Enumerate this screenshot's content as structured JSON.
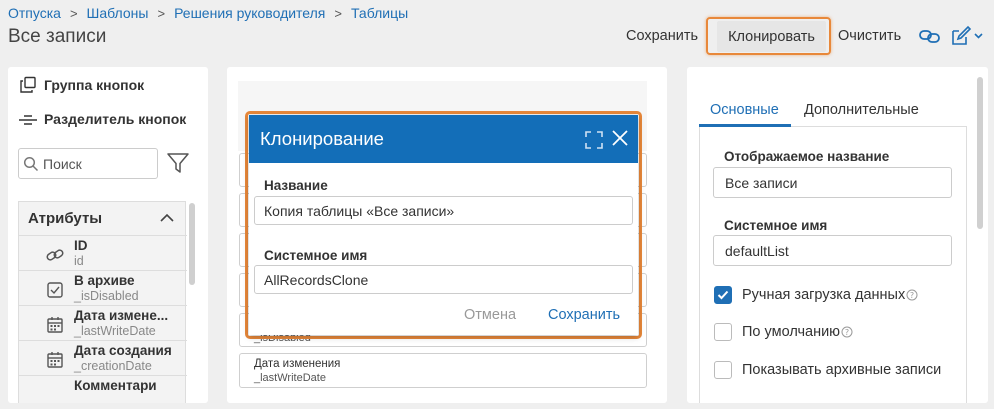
{
  "breadcrumb": [
    "Отпуска",
    "Шаблоны",
    "Решения руководителя",
    "Таблицы"
  ],
  "page_title": "Все записи",
  "toolbar": {
    "save_label": "Сохранить",
    "clone_label": "Клонировать",
    "clear_label": "Очистить"
  },
  "left_panel": {
    "tools": {
      "button_group": "Группа кнопок",
      "button_separator": "Разделитель кнопок"
    },
    "search": {
      "placeholder": "Поиск"
    },
    "attributes": {
      "header": "Атрибуты",
      "items": [
        {
          "name": "ID",
          "sys": "id",
          "icon": "link-icon"
        },
        {
          "name": "В архиве",
          "sys": "_isDisabled",
          "icon": "checkbox-icon"
        },
        {
          "name": "Дата измене...",
          "sys": "_lastWriteDate",
          "icon": "calendar-icon"
        },
        {
          "name": "Дата создания",
          "sys": "_creationDate",
          "icon": "calendar-icon"
        },
        {
          "name": "Комментари",
          "sys": "",
          "icon": "text-icon"
        }
      ]
    }
  },
  "center_panel": {
    "partial_row_label": "_isDisabled",
    "last_row": {
      "title": "Дата изменения",
      "sys": "_lastWriteDate"
    }
  },
  "dialog": {
    "title": "Клонирование",
    "name_label": "Название",
    "name_value": "Копия таблицы «Все записи»",
    "sysname_label": "Системное имя",
    "sysname_value": "AllRecordsClone",
    "cancel_label": "Отмена",
    "save_label": "Сохранить"
  },
  "right_panel": {
    "tabs": {
      "main": "Основные",
      "extra": "Дополнительные"
    },
    "display_name_label": "Отображаемое название",
    "display_name_value": "Все записи",
    "system_name_label": "Системное имя",
    "system_name_value": "defaultList",
    "checkboxes": {
      "manual_load": {
        "label": "Ручная загрузка данных",
        "checked": true
      },
      "default": {
        "label": "По умолчанию",
        "checked": false
      },
      "show_archived": {
        "label": "Показывать архивные записи",
        "checked": false
      }
    }
  },
  "colors": {
    "accent": "#1f6fb5",
    "dialog_header": "#136eb8",
    "highlight": "#e8883a"
  }
}
